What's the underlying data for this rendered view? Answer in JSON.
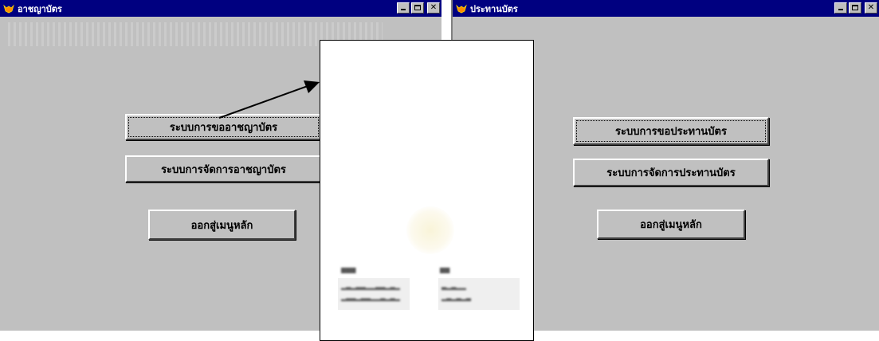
{
  "left_window": {
    "title": "อาชญาบัตร",
    "buttons": {
      "request": "ระบบการขออาชญาบัตร",
      "manage": "ระบบการจัดการอาชญาบัตร",
      "exit": "ออกสู่เมนูหลัก"
    }
  },
  "right_window": {
    "title": "ประทานบัตร",
    "buttons": {
      "request": "ระบบการขอประทานบัตร",
      "manage": "ระบบการจัดการประทานบัตร",
      "exit": "ออกสู่เมนูหลัก"
    }
  },
  "colors": {
    "titlebar": "#000080",
    "window_face": "#c0c0c0"
  },
  "icons": [
    "app-icon",
    "minimize-icon",
    "maximize-icon",
    "close-icon"
  ]
}
